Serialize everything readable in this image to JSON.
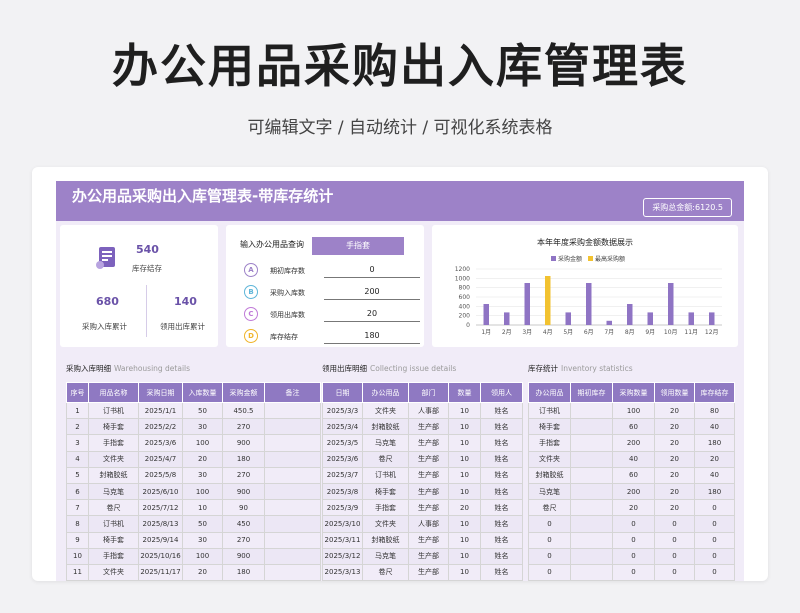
{
  "header": {
    "title": "办公用品采购出入库管理表",
    "subtitle": "可编辑文字 / 自动统计 / 可视化系统表格"
  },
  "sheet": {
    "title": "办公用品采购出入库管理表-带库存统计",
    "total_label": "采购总金额:6120.5"
  },
  "kpi": {
    "stock_value": "540",
    "stock_label": "库存结存",
    "purchase_value": "680",
    "purchase_label": "采购入库累计",
    "issue_value": "140",
    "issue_label": "领用出库累计"
  },
  "query": {
    "title": "输入办公用品查询",
    "selected_item": "手指套",
    "rows": [
      {
        "badge": "A",
        "label": "期初库存数",
        "value": "0",
        "color": "#9d82c8"
      },
      {
        "badge": "B",
        "label": "采购入库数",
        "value": "200",
        "color": "#5fb6d9"
      },
      {
        "badge": "C",
        "label": "领用出库数",
        "value": "20",
        "color": "#c07ad8"
      },
      {
        "badge": "D",
        "label": "库存结存",
        "value": "180",
        "color": "#f0b429"
      }
    ]
  },
  "chart_data": {
    "type": "bar",
    "title": "本年年度采购金额数据展示",
    "categories": [
      "1月",
      "2月",
      "3月",
      "4月",
      "5月",
      "6月",
      "7月",
      "8月",
      "9月",
      "10月",
      "11月",
      "12月"
    ],
    "series": [
      {
        "name": "采购金额",
        "color": "#8f74c4",
        "values": [
          450,
          270,
          900,
          0,
          270,
          900,
          90,
          450,
          270,
          900,
          270,
          270
        ]
      },
      {
        "name": "最高采购额",
        "color": "#f2c230",
        "values": [
          0,
          0,
          0,
          1050,
          0,
          0,
          0,
          0,
          0,
          0,
          0,
          0
        ]
      }
    ],
    "ylim": [
      0,
      1200
    ],
    "yticks": [
      "0",
      "200",
      "400",
      "600",
      "800",
      "1000",
      "1200"
    ],
    "legend_position": "top"
  },
  "purchase": {
    "title": "采购入库明细",
    "title_en": "Warehousing details",
    "headers": [
      "序号",
      "用品名称",
      "采购日期",
      "入库数量",
      "采购金额",
      "备注"
    ],
    "rows": [
      [
        "1",
        "订书机",
        "2025/1/1",
        "50",
        "450.5",
        ""
      ],
      [
        "2",
        "椅手套",
        "2025/2/2",
        "30",
        "270",
        ""
      ],
      [
        "3",
        "手指套",
        "2025/3/6",
        "100",
        "900",
        ""
      ],
      [
        "4",
        "文件夹",
        "2025/4/7",
        "20",
        "180",
        ""
      ],
      [
        "5",
        "封箱胶纸",
        "2025/5/8",
        "30",
        "270",
        ""
      ],
      [
        "6",
        "马克笔",
        "2025/6/10",
        "100",
        "900",
        ""
      ],
      [
        "7",
        "卷尺",
        "2025/7/12",
        "10",
        "90",
        ""
      ],
      [
        "8",
        "订书机",
        "2025/8/13",
        "50",
        "450",
        ""
      ],
      [
        "9",
        "椅手套",
        "2025/9/14",
        "30",
        "270",
        ""
      ],
      [
        "10",
        "手指套",
        "2025/10/16",
        "100",
        "900",
        ""
      ],
      [
        "11",
        "文件夹",
        "2025/11/17",
        "20",
        "180",
        ""
      ]
    ]
  },
  "issue": {
    "title": "领用出库明细",
    "title_en": "Collecting issue details",
    "headers": [
      "日期",
      "办公用品",
      "部门",
      "数量",
      "领用人"
    ],
    "rows": [
      [
        "2025/3/3",
        "文件夹",
        "人事部",
        "10",
        "姓名"
      ],
      [
        "2025/3/4",
        "封箱胶纸",
        "生产部",
        "10",
        "姓名"
      ],
      [
        "2025/3/5",
        "马克笔",
        "生产部",
        "10",
        "姓名"
      ],
      [
        "2025/3/6",
        "卷尺",
        "生产部",
        "10",
        "姓名"
      ],
      [
        "2025/3/7",
        "订书机",
        "生产部",
        "10",
        "姓名"
      ],
      [
        "2025/3/8",
        "椅手套",
        "生产部",
        "10",
        "姓名"
      ],
      [
        "2025/3/9",
        "手指套",
        "生产部",
        "20",
        "姓名"
      ],
      [
        "2025/3/10",
        "文件夹",
        "人事部",
        "10",
        "姓名"
      ],
      [
        "2025/3/11",
        "封箱胶纸",
        "生产部",
        "10",
        "姓名"
      ],
      [
        "2025/3/12",
        "马克笔",
        "生产部",
        "10",
        "姓名"
      ],
      [
        "2025/3/13",
        "卷尺",
        "生产部",
        "10",
        "姓名"
      ]
    ]
  },
  "inventory": {
    "title": "库存统计",
    "title_en": "Inventory statistics",
    "headers": [
      "办公用品",
      "期初库存",
      "采购数量",
      "领用数量",
      "库存结存"
    ],
    "rows": [
      [
        "订书机",
        "",
        "100",
        "20",
        "80"
      ],
      [
        "椅手套",
        "",
        "60",
        "20",
        "40"
      ],
      [
        "手指套",
        "",
        "200",
        "20",
        "180"
      ],
      [
        "文件夹",
        "",
        "40",
        "20",
        "20"
      ],
      [
        "封箱胶纸",
        "",
        "60",
        "20",
        "40"
      ],
      [
        "马克笔",
        "",
        "200",
        "20",
        "180"
      ],
      [
        "卷尺",
        "",
        "20",
        "20",
        "0"
      ],
      [
        "0",
        "",
        "0",
        "0",
        "0"
      ],
      [
        "0",
        "",
        "0",
        "0",
        "0"
      ],
      [
        "0",
        "",
        "0",
        "0",
        "0"
      ],
      [
        "0",
        "",
        "0",
        "0",
        "0"
      ]
    ]
  }
}
